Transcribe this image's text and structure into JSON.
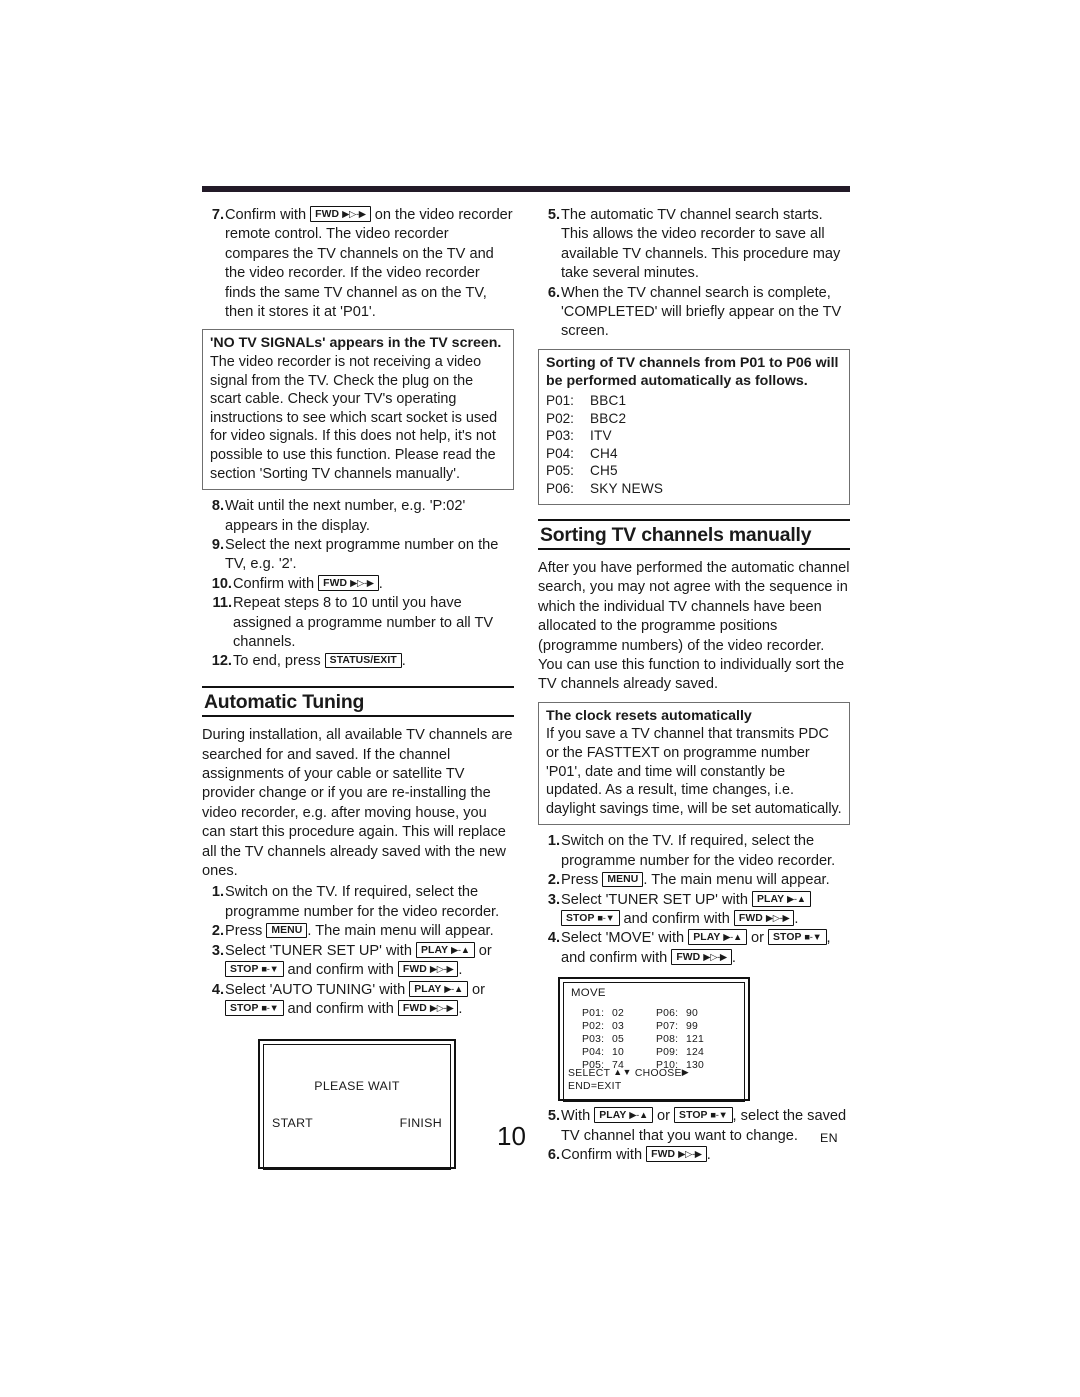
{
  "page": {
    "number": "10",
    "language_mark": "EN"
  },
  "keys": {
    "fwd": "FWD",
    "fwd_glyph": "▶▷-▶",
    "play": "PLAY",
    "play_glyph": "▶-▲",
    "stop": "STOP",
    "stop_glyph": "■-▼",
    "menu": "MENU",
    "status_exit": "STATUS/EXIT"
  },
  "left_column": {
    "steps_top": [
      {
        "num": "7.",
        "parts": [
          {
            "t": "text",
            "v": "Confirm with "
          },
          {
            "t": "key",
            "v": "fwd"
          },
          {
            "t": "text",
            "v": " on the video recorder remote control. The video recorder compares the TV channels on the TV and the video recorder."
          }
        ],
        "extra_line": "If the video recorder finds the same TV channel as on the TV, then it stores it at 'P01'."
      }
    ],
    "note_no_signal": {
      "title": "'NO TV SIGNALs' appears in the TV screen.",
      "text": "The video recorder is not receiving a video signal from the TV. Check the plug on the scart cable. Check your TV's operating instructions to see which scart socket is used for video signals. If this does not help, it's not possible to use this function. Please read the section 'Sorting TV channels manually'."
    },
    "steps_mid": [
      {
        "num": "8.",
        "text": "Wait until the next number, e.g. 'P:02' appears in the display."
      },
      {
        "num": "9.",
        "text": "Select the next programme number on the TV, e.g. '2'."
      },
      {
        "num": "10.",
        "prefix": "Confirm with ",
        "key": "fwd",
        "suffix": "."
      },
      {
        "num": "11.",
        "text": "Repeat steps 8 to 10 until you have assigned a programme number to all TV channels."
      },
      {
        "num": "12.",
        "prefix": "To end, press ",
        "key": "status_exit",
        "suffix": "."
      }
    ],
    "section": {
      "heading": "Automatic Tuning",
      "intro": "During installation, all available TV channels are searched for and saved. If the channel assignments of your cable or satellite TV provider change or if you are re-installing the video recorder, e.g. after moving house, you can start this procedure again. This will replace all the TV channels already saved with the new ones."
    },
    "steps_auto": [
      {
        "num": "1.",
        "text": "Switch on the TV. If required, select the programme number for the video recorder."
      },
      {
        "num": "2.",
        "prefix": "Press ",
        "key": "menu",
        "suffix": ". The main menu will appear."
      },
      {
        "num": "3.",
        "select_prefix": "Select 'TUNER SET UP' with ",
        "key_a": "play",
        "or": " or ",
        "key_b": "stop",
        "confirm": " and confirm with ",
        "key_c": "fwd",
        "suffix": "."
      },
      {
        "num": "4.",
        "select_prefix": "Select 'AUTO TUNING' with ",
        "key_a": "play",
        "or": " or ",
        "key_b": "stop",
        "confirm": " and confirm with ",
        "key_c": "fwd",
        "suffix": "."
      }
    ],
    "osd_wait": {
      "label": "PLEASE WAIT",
      "start": "START",
      "finish": "FINISH"
    }
  },
  "right_column": {
    "steps_top": [
      {
        "num": "5.",
        "text": "The automatic TV channel search starts. This allows the video recorder to save all available TV channels. This procedure may take several minutes."
      },
      {
        "num": "6.",
        "text": "When the TV channel search is complete, 'COMPLETED' will briefly appear on the TV screen."
      }
    ],
    "note_sorting": {
      "title": "Sorting of TV channels from P01 to P06 will be performed automatically as follows.",
      "channels": [
        {
          "pos": "P01:",
          "name": "BBC1"
        },
        {
          "pos": "P02:",
          "name": "BBC2"
        },
        {
          "pos": "P03:",
          "name": "ITV"
        },
        {
          "pos": "P04:",
          "name": "CH4"
        },
        {
          "pos": "P05:",
          "name": "CH5"
        },
        {
          "pos": "P06:",
          "name": "SKY NEWS"
        }
      ]
    },
    "section": {
      "heading": "Sorting TV channels manually",
      "intro": "After you have performed the automatic channel search, you may not agree with the sequence in which the individual TV channels have been allocated to the programme positions (programme numbers) of the video recorder. You can use this function to individually sort the TV channels already saved."
    },
    "note_clock": {
      "title": "The clock resets automatically",
      "text": "If you save a TV channel that transmits PDC or the FASTTEXT on programme number 'P01', date and time will constantly be updated. As a result, time changes, i.e. daylight savings time, will be set automatically."
    },
    "steps_manual": [
      {
        "num": "1.",
        "text": "Switch on the TV. If required, select the programme number for the video recorder."
      },
      {
        "num": "2.",
        "prefix": "Press ",
        "key": "menu",
        "suffix": ". The main menu will appear."
      },
      {
        "num": "3.",
        "select_prefix": "Select 'TUNER SET UP' with ",
        "key_a": "play",
        "mid": "",
        "key_b": "stop",
        "confirm": " and confirm with ",
        "key_c": "fwd",
        "suffix": "."
      },
      {
        "num": "4.",
        "select_prefix": "Select 'MOVE' with ",
        "key_a": "play",
        "or": " or ",
        "key_b": "stop",
        "confirm": ", and confirm with ",
        "key_c": "fwd",
        "suffix": "."
      }
    ],
    "osd_move": {
      "title": "MOVE",
      "rows": [
        {
          "lp": "P01:",
          "lv": "02",
          "rp": "P06:",
          "rv": "90"
        },
        {
          "lp": "P02:",
          "lv": "03",
          "rp": "P07:",
          "rv": "99"
        },
        {
          "lp": "P03:",
          "lv": "05",
          "rp": "P08:",
          "rv": "121"
        },
        {
          "lp": "P04:",
          "lv": "10",
          "rp": "P09:",
          "rv": "124"
        },
        {
          "lp": "P05:",
          "lv": "74",
          "rp": "P10:",
          "rv": "130"
        }
      ],
      "footer_select": "SELECT",
      "footer_choose": "CHOOSE",
      "footer_end": "END=EXIT"
    },
    "steps_end": [
      {
        "num": "5.",
        "prefix": "With ",
        "key_a": "play",
        "or": " or ",
        "key_b": "stop",
        "suffix": ", select the saved TV channel that you want to change."
      },
      {
        "num": "6.",
        "prefix": "Confirm with ",
        "key_c": "fwd",
        "suffix": "."
      }
    ]
  }
}
